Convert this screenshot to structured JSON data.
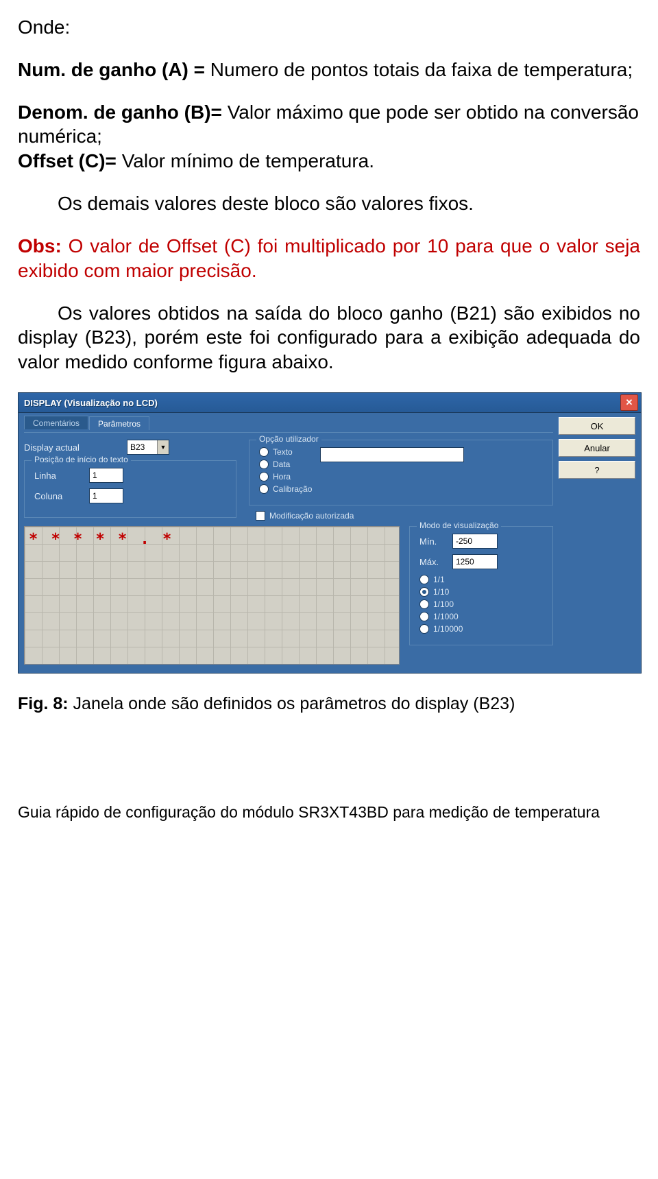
{
  "doc": {
    "onde": "Onde:",
    "p1_prefix": "Num. de ganho (A) = ",
    "p1_rest": "Numero de pontos totais da faixa de temperatura;",
    "p2_prefix": "Denom. de ganho (B)= ",
    "p2_rest": "Valor máximo que pode ser obtido na conversão numérica;",
    "p3_prefix": "Offset (C)= ",
    "p3_rest": "Valor mínimo de temperatura.",
    "p4": "Os demais valores deste bloco são valores fixos.",
    "obs_prefix": "Obs:",
    "obs_rest": " O valor de Offset (C) foi multiplicado por 10 para que o valor seja exibido com maior precisão.",
    "p5": "Os valores obtidos na saída do bloco ganho (B21) são exibidos no display (B23), porém este foi configurado para a exibição adequada do valor medido conforme figura abaixo.",
    "caption_prefix": "Fig. 8:",
    "caption_rest": " Janela onde são definidos os parâmetros do display (B23)",
    "footer": "Guia rápido de configuração do módulo SR3XT43BD para medição de temperatura"
  },
  "dialog": {
    "title": "DISPLAY (Visualização no LCD)",
    "close": "✕",
    "tabs": {
      "comments": "Comentários",
      "params": "Parâmetros"
    },
    "buttons": {
      "ok": "OK",
      "cancel": "Anular",
      "help": "?"
    },
    "display_actual_label": "Display actual",
    "display_actual_value": "B23",
    "pos_group": "Posição de início do texto",
    "linha_label": "Linha",
    "linha_value": "1",
    "coluna_label": "Coluna",
    "coluna_value": "1",
    "user_group": "Opção utilizador",
    "opts": {
      "texto": "Texto",
      "data": "Data",
      "hora": "Hora",
      "calib": "Calibração"
    },
    "texto_value": "",
    "mod_auth": "Modificação autorizada",
    "preview": "* * * * * . *",
    "viz_group": "Modo de visualização",
    "min_label": "Mín.",
    "min_value": "-250",
    "max_label": "Máx.",
    "max_value": "1250",
    "ratios": {
      "r1": "1/1",
      "r10": "1/10",
      "r100": "1/100",
      "r1000": "1/1000",
      "r10000": "1/10000"
    }
  }
}
